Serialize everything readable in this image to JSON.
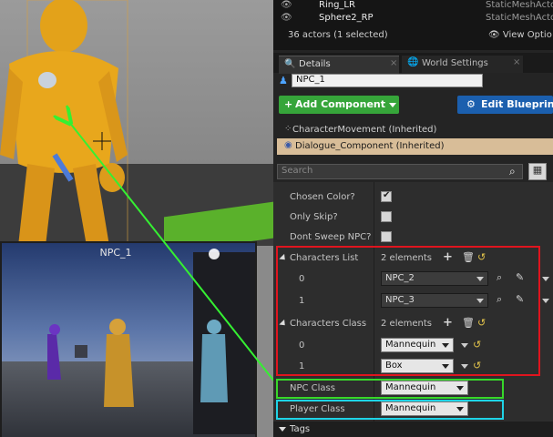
{
  "outliner": {
    "rows": [
      {
        "name": "Ring_LR",
        "type": "StaticMeshActo"
      },
      {
        "name": "Sphere2_RP",
        "type": "StaticMeshActo"
      }
    ],
    "count": "36 actors (1 selected)",
    "view_options": "View Optio"
  },
  "tabs": {
    "details": "Details",
    "world_settings": "World Settings"
  },
  "details": {
    "name_value": "NPC_1",
    "add_component": "Add Component",
    "edit_blueprint": "Edit Blueprin",
    "components": [
      "CharacterMovement (Inherited)",
      "Dialogue_Component (Inherited)"
    ],
    "search_placeholder": "Search",
    "props": {
      "chosen_color": "Chosen Color?",
      "only_skip": "Only Skip?",
      "dont_sweep": "Dont Sweep NPC?",
      "characters_list": "Characters List",
      "characters_list_count": "2 elements",
      "list_items": [
        {
          "index": "0",
          "value": "NPC_2"
        },
        {
          "index": "1",
          "value": "NPC_3"
        }
      ],
      "characters_class": "Characters Class",
      "characters_class_count": "2 elements",
      "class_items": [
        {
          "index": "0",
          "value": "Mannequin"
        },
        {
          "index": "1",
          "value": "Box"
        }
      ],
      "npc_class": "NPC Class",
      "npc_class_value": "Mannequin",
      "player_class": "Player Class",
      "player_class_value": "Mannequin",
      "tags": "Tags"
    }
  },
  "viewport": {
    "pip_title": "NPC_1"
  },
  "colors": {
    "red_box": "#e0141e",
    "green_box": "#37d82a",
    "cyan_box": "#1fd3e6",
    "arrow": "#35f032"
  }
}
